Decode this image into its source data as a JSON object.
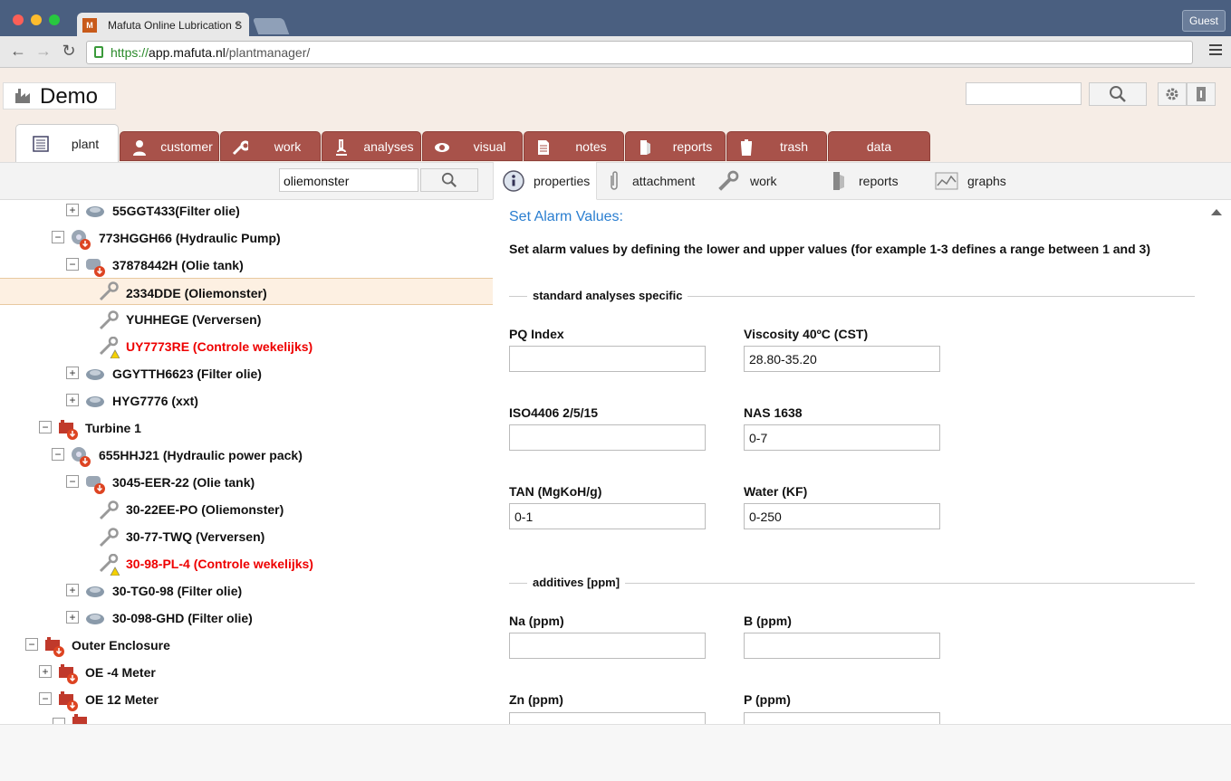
{
  "browser": {
    "tab_title": "Mafuta Online Lubrication S",
    "tab_close": "×",
    "favicon_text": "M",
    "profile": "Guest",
    "url_scheme": "https://",
    "url_host": "app.mafuta.nl",
    "url_path": "/plantmanager/"
  },
  "header": {
    "title": "Demo"
  },
  "main_tabs": [
    {
      "label": "plant",
      "icon": "plant-list-icon"
    },
    {
      "label": "customer",
      "icon": "person-icon"
    },
    {
      "label": "work",
      "icon": "wrench-icon"
    },
    {
      "label": "analyses",
      "icon": "microscope-icon"
    },
    {
      "label": "visual",
      "icon": "eye-icon"
    },
    {
      "label": "notes",
      "icon": "document-icon"
    },
    {
      "label": "reports",
      "icon": "report-icon"
    },
    {
      "label": "trash",
      "icon": "trash-icon"
    },
    {
      "label": "data",
      "icon": ""
    }
  ],
  "tree_search": {
    "value": "oliemonster"
  },
  "sub_tabs": [
    {
      "label": "properties",
      "icon": "info-icon"
    },
    {
      "label": "attachment",
      "icon": "paperclip-icon"
    },
    {
      "label": "work",
      "icon": "wrench-icon"
    },
    {
      "label": "reports",
      "icon": "report-icon"
    },
    {
      "label": "graphs",
      "icon": "graph-icon"
    }
  ],
  "tree": [
    {
      "label": "55GGT433(Filter olie)",
      "toggle": "+",
      "icon": "filter-icon"
    },
    {
      "label": "773HGGH66 (Hydraulic Pump)",
      "toggle": "−",
      "icon": "pump-icon"
    },
    {
      "label": "37878442H (Olie tank)",
      "toggle": "−",
      "icon": "tank-icon"
    },
    {
      "label": "2334DDE (Oliemonster)",
      "toggle": "",
      "icon": "wrench-icon"
    },
    {
      "label": "YUHHEGE (Verversen)",
      "toggle": "",
      "icon": "wrench-icon"
    },
    {
      "label": "UY7773RE (Controle wekelijks)",
      "toggle": "",
      "icon": "wrench-warning-icon"
    },
    {
      "label": "GGYTTH6623 (Filter olie)",
      "toggle": "+",
      "icon": "filter-icon"
    },
    {
      "label": "HYG7776 (xxt)",
      "toggle": "+",
      "icon": "filter-icon"
    },
    {
      "label": "Turbine 1",
      "toggle": "−",
      "icon": "machine-icon"
    },
    {
      "label": "655HHJ21 (Hydraulic power pack)",
      "toggle": "−",
      "icon": "pump-icon"
    },
    {
      "label": "3045-EER-22 (Olie tank)",
      "toggle": "−",
      "icon": "tank-icon"
    },
    {
      "label": "30-22EE-PO (Oliemonster)",
      "toggle": "",
      "icon": "wrench-icon"
    },
    {
      "label": "30-77-TWQ (Verversen)",
      "toggle": "",
      "icon": "wrench-icon"
    },
    {
      "label": "30-98-PL-4 (Controle wekelijks)",
      "toggle": "",
      "icon": "wrench-warning-icon"
    },
    {
      "label": "30-TG0-98 (Filter olie)",
      "toggle": "+",
      "icon": "filter-icon"
    },
    {
      "label": "30-098-GHD (Filter olie)",
      "toggle": "+",
      "icon": "filter-icon"
    },
    {
      "label": "Outer Enclosure",
      "toggle": "−",
      "icon": "machine-icon"
    },
    {
      "label": "OE -4 Meter",
      "toggle": "+",
      "icon": "machine-icon"
    },
    {
      "label": "OE 12 Meter",
      "toggle": "−",
      "icon": "machine-icon"
    }
  ],
  "panel": {
    "title": "Set Alarm Values:",
    "description": "Set alarm values by defining the lower and upper values (for example 1-3 defines a range between 1 and 3)",
    "sections": [
      {
        "title": "standard analyses specific",
        "fields": [
          {
            "label": "PQ Index",
            "value": ""
          },
          {
            "label": "Viscosity 40ºC (CST)",
            "value": "28.80-35.20"
          },
          {
            "label": "ISO4406 2/5/15",
            "value": ""
          },
          {
            "label": "NAS 1638",
            "value": "0-7"
          },
          {
            "label": "TAN (MgKoH/g)",
            "value": "0-1"
          },
          {
            "label": "Water (KF)",
            "value": "0-250"
          }
        ]
      },
      {
        "title": "additives [ppm]",
        "fields": [
          {
            "label": "Na (ppm)",
            "value": ""
          },
          {
            "label": "B (ppm)",
            "value": ""
          },
          {
            "label": "Zn (ppm)",
            "value": ""
          },
          {
            "label": "P (ppm)",
            "value": ""
          }
        ]
      }
    ]
  },
  "colors": {
    "tab_red": "#a8524a",
    "link_blue": "#2a7ed0",
    "alert_red": "#e00000",
    "header_bg": "#f6ede6"
  }
}
